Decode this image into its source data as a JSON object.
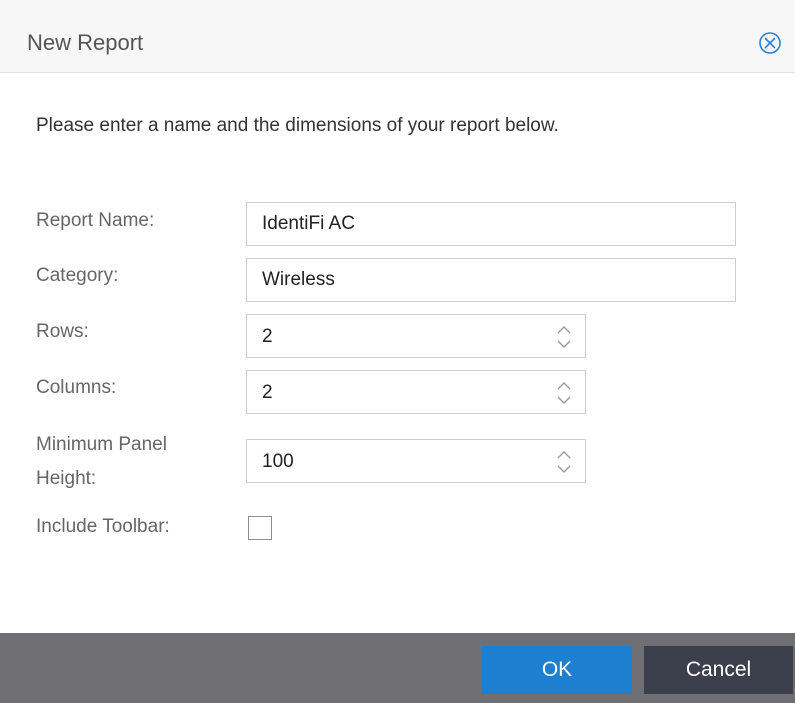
{
  "dialog": {
    "title": "New Report",
    "close_icon": "close-circle-icon",
    "instructions": "Please enter a name and the dimensions of your report below."
  },
  "form": {
    "report_name": {
      "label": "Report Name:",
      "value": "IdentiFi AC"
    },
    "category": {
      "label": "Category:",
      "value": "Wireless"
    },
    "rows": {
      "label": "Rows:",
      "value": "2"
    },
    "columns": {
      "label": "Columns:",
      "value": "2"
    },
    "min_panel_height": {
      "label_line1": "Minimum Panel",
      "label_line2": "Height:",
      "value": "100"
    },
    "include_toolbar": {
      "label": "Include Toolbar:",
      "checked": false
    }
  },
  "footer": {
    "ok_label": "OK",
    "cancel_label": "Cancel"
  },
  "colors": {
    "accent": "#1c7fd0",
    "footer_bg": "#6e6e73",
    "cancel_bg": "#3a3f4b",
    "close_icon": "#2a7fd6"
  }
}
